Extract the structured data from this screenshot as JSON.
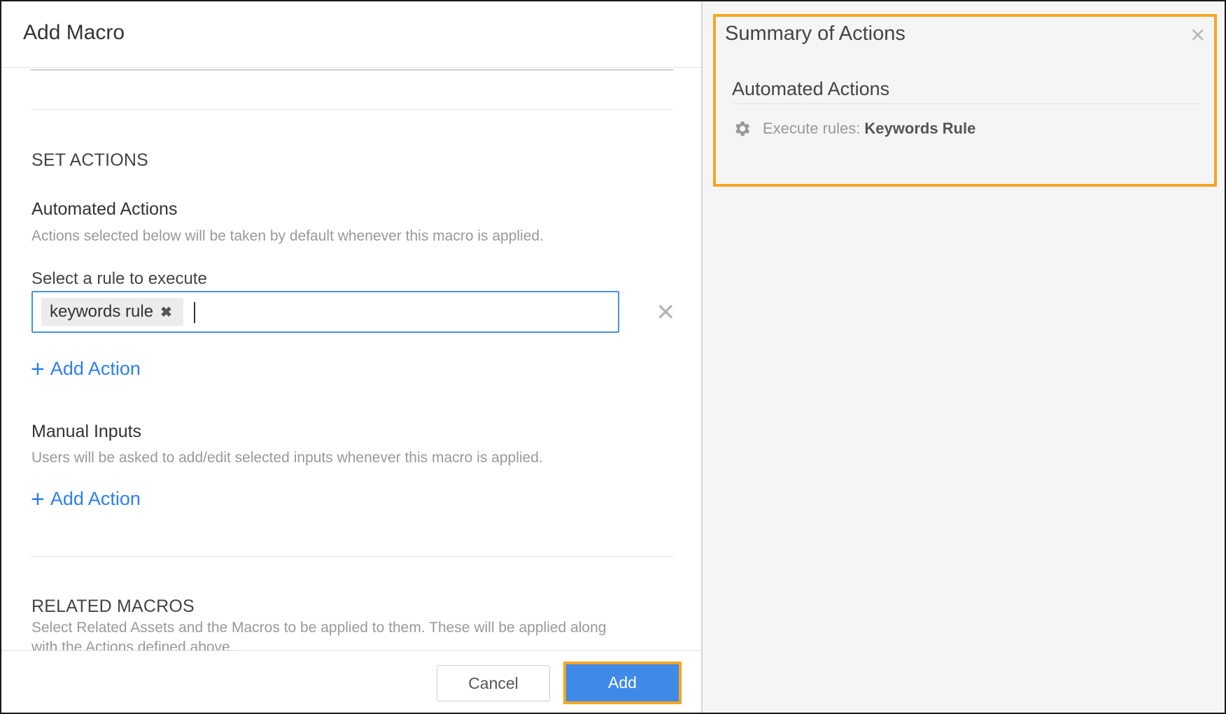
{
  "modal": {
    "title": "Add Macro",
    "set_actions": {
      "heading": "SET ACTIONS",
      "automated": {
        "title": "Automated Actions",
        "description": "Actions selected below will be taken by default whenever this macro is applied.",
        "rule_label": "Select a rule to execute",
        "selected_tag": "keywords rule",
        "add_action": "Add Action"
      },
      "manual": {
        "title": "Manual Inputs",
        "description": "Users will be asked to add/edit selected inputs whenever this macro is applied.",
        "add_action": "Add Action"
      }
    },
    "related": {
      "heading": "RELATED MACROS",
      "description_line1": "Select Related Assets and the Macros to be applied to them. These will be applied along",
      "description_line2": "with the Actions defined above."
    },
    "footer": {
      "cancel_label": "Cancel",
      "add_label": "Add"
    }
  },
  "summary": {
    "title": "Summary of Actions",
    "section_title": "Automated Actions",
    "line_label": "Execute rules:",
    "line_value": "Keywords Rule"
  },
  "icons": {
    "close": "close-icon",
    "tag_remove": "x-icon",
    "plus": "plus-icon",
    "gear": "gear-icon"
  },
  "colors": {
    "accent_blue": "#3f8ae8",
    "link_blue": "#2f80ed",
    "highlight_orange": "#f5a623"
  }
}
